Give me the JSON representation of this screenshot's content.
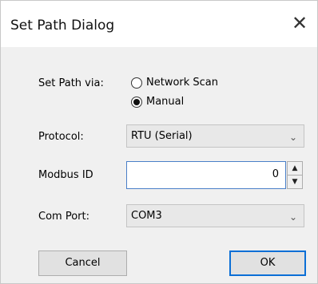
{
  "dialog": {
    "title": "Set Path Dialog",
    "close_glyph": "✕"
  },
  "set_path": {
    "label": "Set Path via:",
    "options": [
      {
        "label": "Network Scan",
        "checked": false
      },
      {
        "label": "Manual",
        "checked": true
      }
    ]
  },
  "protocol": {
    "label": "Protocol:",
    "value": "RTU (Serial)"
  },
  "modbus_id": {
    "label": "Modbus ID",
    "value": "0"
  },
  "com_port": {
    "label": "Com Port:",
    "value": "COM3"
  },
  "buttons": {
    "cancel": "Cancel",
    "ok": "OK"
  },
  "icons": {
    "chevron": "chevron-down-icon",
    "spin_up": "arrow-up-icon",
    "spin_down": "arrow-down-icon"
  },
  "colors": {
    "accent": "#0b6fd6",
    "focus_border": "#4a7fc8"
  }
}
